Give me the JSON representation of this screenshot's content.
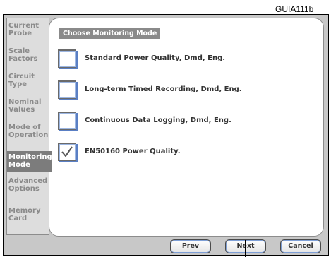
{
  "figure_label": "GUIA111b",
  "sidebar": {
    "items": [
      {
        "label": "Current\nProbe",
        "active": false
      },
      {
        "label": "Scale\nFactors",
        "active": false
      },
      {
        "label": "Circuit\nType",
        "active": false
      },
      {
        "label": "Nominal\nValues",
        "active": false
      },
      {
        "label": "Mode of\nOperation",
        "active": false
      },
      {
        "label": "Monitoring\nMode",
        "active": true
      },
      {
        "label": "Advanced\nOptions",
        "active": false
      },
      {
        "label": "Memory\nCard",
        "active": false
      }
    ]
  },
  "panel": {
    "section_title": "Choose Monitoring Mode",
    "options": [
      {
        "label": "Standard Power Quality, Dmd, Eng.",
        "checked": false
      },
      {
        "label": "Long-term Timed Recording, Dmd, Eng.",
        "checked": false
      },
      {
        "label": "Continuous Data Logging, Dmd, Eng.",
        "checked": false
      },
      {
        "label": "EN50160 Power Quality.",
        "checked": true
      }
    ]
  },
  "buttons": {
    "prev": "Prev",
    "next": "Next",
    "cancel": "Cancel"
  },
  "colors": {
    "checkbox_accent": "#5a7fc4",
    "active_tab": "#7c7c7c"
  }
}
